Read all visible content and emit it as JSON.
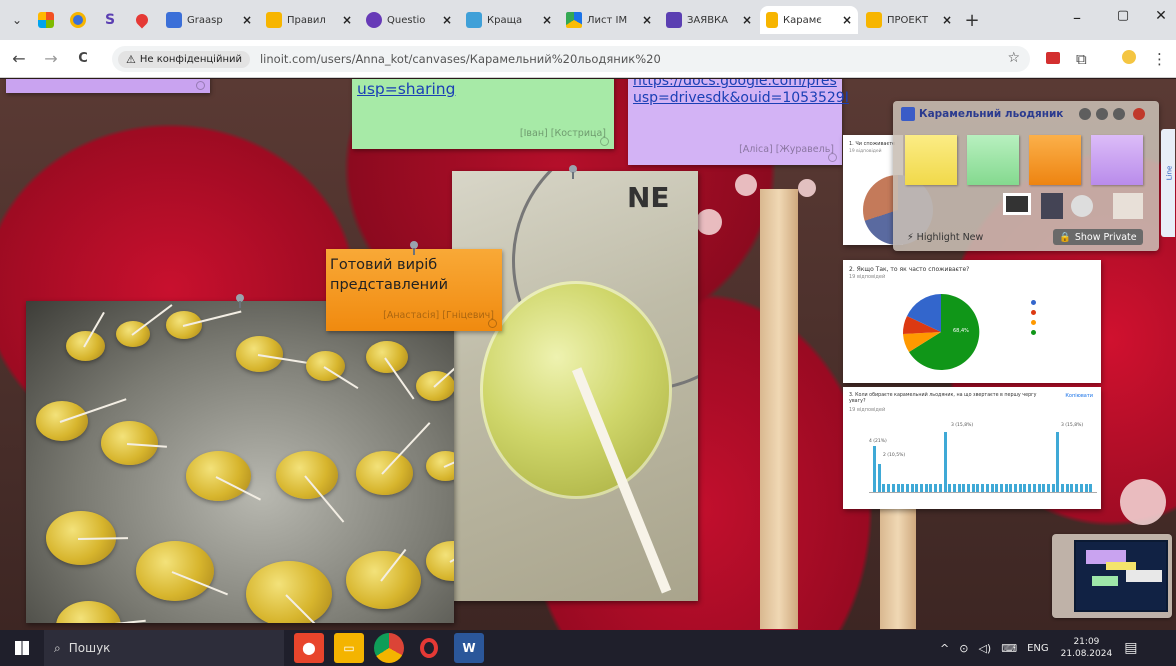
{
  "browser": {
    "pinned_tabs": [
      "pinned-app-1",
      "pinned-app-2",
      "pinned-app-3",
      "pinned-app-4"
    ],
    "tabs": [
      {
        "label": "Graasp",
        "close": "×",
        "color": "#3b6fd8",
        "active": false
      },
      {
        "label": "Правил",
        "close": "×",
        "color": "#f7b500",
        "active": false
      },
      {
        "label": "Questio",
        "close": "×",
        "color": "#673ab7",
        "active": false
      },
      {
        "label": "Краща",
        "close": "×",
        "color": "#3fa0d8",
        "active": false
      },
      {
        "label": "Лист ІМ",
        "close": "×",
        "color": "#1a73e8",
        "active": false
      },
      {
        "label": "ЗАЯВКА",
        "close": "×",
        "color": "#5b3fb2",
        "active": false
      },
      {
        "label": "Карамє",
        "close": "×",
        "color": "#f7b500",
        "active": true
      },
      {
        "label": "ПРОЕКТ",
        "close": "×",
        "color": "#f7b500",
        "active": false
      }
    ],
    "new_tab": "+",
    "window_controls": {
      "minimize": "–",
      "restore": "▢",
      "close": "✕"
    },
    "nav": {
      "back": "←",
      "forward": "→",
      "reload": "C"
    },
    "security_label": "Не конфіденційний",
    "url": "linoit.com/users/Anna_kot/canvases/Карамельний%20льодяник%20"
  },
  "notes": [
    {
      "id": "green",
      "text": "usp=sharing",
      "author": "[Іван] [Кострица]"
    },
    {
      "id": "purple",
      "line1": "https://docs.google.com/pres",
      "line2": "usp=drivesdk&ouid=1053529I",
      "author": "[Аліса] [Журавель]"
    },
    {
      "id": "orange",
      "text": "Готовий виріб представлений",
      "author": "[Анастасія] [Гніцевич]"
    }
  ],
  "photo_lollipop_closeup": {
    "dial_text": "NE"
  },
  "survey": {
    "q1": "1. Чи споживаєте",
    "q1_sub": "19 відповідей",
    "q2": "2. Якщо Так, то як часто споживаєте?",
    "q2_sub": "19 відповідей",
    "q3": "3. Коли обираєте карамельний льодяник, на що звертаєте в першу чергу увагу?",
    "q3_sub": "19 відповідей",
    "q3_copy": "Копіювати",
    "pie_center": "68,4%",
    "legend_colors": [
      "#3366cc",
      "#dc3912",
      "#ff9900",
      "#109618"
    ],
    "bar_labels": [
      "4 (21%)",
      "2 (10,5%)",
      "3 (15,8%)",
      "3 (15,8%)"
    ],
    "bar_color": "#3fa9d6"
  },
  "panel": {
    "title": "Карамельний льодяник",
    "note_colors": [
      "#f4e46b",
      "#9ee6a8",
      "#f79a1f",
      "#c89df2"
    ],
    "highlight_label": "Highlight New",
    "show_private_label": "Show Private"
  },
  "sidetab": {
    "label": "Line"
  },
  "taskbar": {
    "search_placeholder": "Пошук",
    "lang": "ENG",
    "time": "21:09",
    "date": "21.08.2024"
  }
}
